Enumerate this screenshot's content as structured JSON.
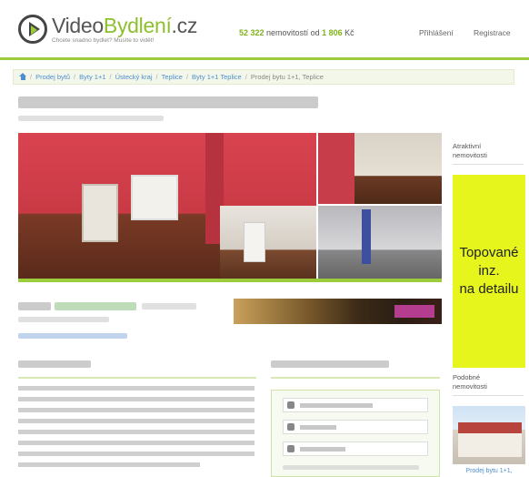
{
  "header": {
    "logo_video": "Video",
    "logo_bydleni": "Bydlení",
    "logo_tld": ".cz",
    "logo_tagline": "Chcete snadno bydlet? Musíte to vidět!",
    "stats_count": "52 322",
    "stats_mid": "nemovitostí od",
    "stats_price": "1 806",
    "stats_currency": "Kč",
    "login": "Přihlášení",
    "register": "Registrace"
  },
  "breadcrumb": {
    "items": [
      "Prodej bytů",
      "Byty 1+1",
      "Ústecký kraj",
      "Teplice",
      "Byty 1+1 Teplice"
    ],
    "current": "Prodej bytu 1+1, Teplice"
  },
  "sidebar": {
    "recent_line1": "Atraktivní",
    "recent_line2": "nemovitosti",
    "ad_line1": "Topované",
    "ad_line2": "inz.",
    "ad_line3": "na detailu",
    "similar_line1": "Podobné",
    "similar_line2": "nemovitosti",
    "similar_caption": "Prodej bytu 1+1,"
  },
  "colors": {
    "accent": "#9ccc3c",
    "link": "#4e8fcf",
    "ad_bg": "#e6f51c"
  },
  "icons": [
    "home-icon",
    "logo-play-icon",
    "user-icon",
    "phone-icon",
    "mail-icon"
  ]
}
